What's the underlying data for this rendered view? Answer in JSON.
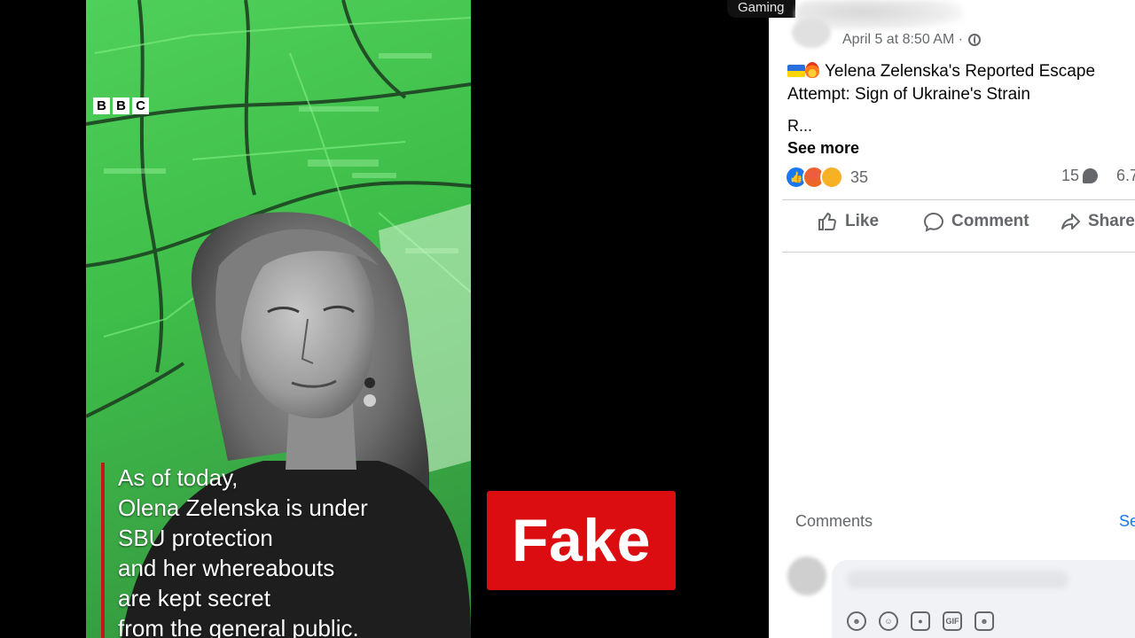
{
  "video": {
    "logo_letters": [
      "B",
      "B",
      "C"
    ],
    "caption_lines": [
      "As of today,",
      "Olena Zelenska is under",
      "SBU protection",
      "and her whereabouts",
      "are kept secret",
      "from the general public."
    ]
  },
  "stamp": {
    "label": "Fake",
    "color": "#dc0d10"
  },
  "top_chip": "Gaming",
  "post": {
    "timestamp": "April 5 at 8:50 AM · ",
    "visibility_icon": "globe-icon",
    "title": "Yelena Zelenska's Reported Escape Attempt: Sign of Ukraine's Strain",
    "title_icons": [
      "ukraine-flag-icon",
      "fire-icon"
    ],
    "body": "R...",
    "see_more": "See more",
    "reactions": {
      "types": [
        "like",
        "angry",
        "haha"
      ],
      "count": "35"
    },
    "comments_count": "15",
    "shares_count": "6.7"
  },
  "actions": {
    "like": "Like",
    "comment": "Comment",
    "share": "Share"
  },
  "comments_section": {
    "label": "Comments",
    "see_link": "Se",
    "composer_tools": [
      "avatar-sticker-icon",
      "emoji-icon",
      "camera-icon",
      "gif-icon",
      "sticker-icon"
    ],
    "gif_label": "GIF"
  },
  "colors": {
    "video_green": "#3fbf4a",
    "facebook_blue": "#1877f2",
    "caption_bar_red": "#c4161c"
  }
}
